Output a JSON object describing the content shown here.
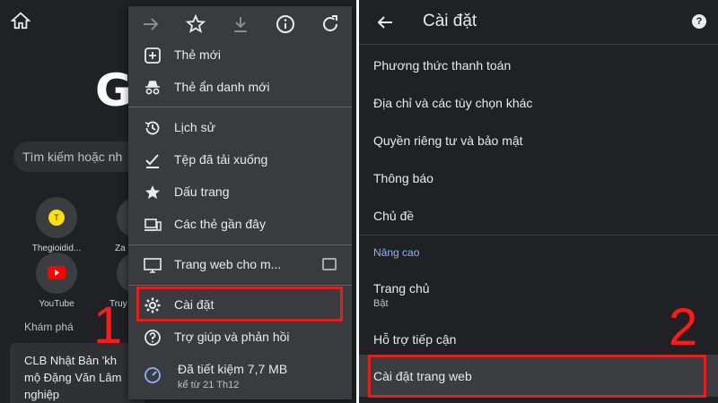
{
  "left": {
    "google_letter": "G",
    "search_placeholder": "Tìm kiếm hoặc nh",
    "shortcuts": [
      {
        "label": "Thegioidid...",
        "initial": "T"
      },
      {
        "label": "Za"
      },
      {
        "label": "YouTube"
      },
      {
        "label": "Truy"
      }
    ],
    "discover_label": "Khám phá",
    "news_text_lines": [
      "CLB Nhật Bản 'kh",
      "mộ Đặng Văn Lâm",
      "nghiệp"
    ]
  },
  "menu": {
    "toolbar_icons": [
      "forward-icon",
      "star-icon",
      "download-icon",
      "info-icon",
      "refresh-icon"
    ],
    "items": [
      {
        "label": "Thẻ mới",
        "icon": "plus-box-icon"
      },
      {
        "label": "Thẻ ẩn danh mới",
        "icon": "incognito-icon"
      },
      {
        "label": "Lịch sử",
        "icon": "history-icon"
      },
      {
        "label": "Tệp đã tải xuống",
        "icon": "download-check-icon"
      },
      {
        "label": "Dấu trang",
        "icon": "star-filled-icon"
      },
      {
        "label": "Các thẻ gần đây",
        "icon": "devices-icon"
      },
      {
        "label": "Trang web cho m...",
        "icon": "monitor-icon"
      },
      {
        "label": "Cài đặt",
        "icon": "gear-icon"
      },
      {
        "label": "Trợ giúp và phản hồi",
        "icon": "help-circle-icon"
      },
      {
        "label": "Đã tiết kiệm 7,7 MB",
        "icon": "speed-icon",
        "sub": "kể từ 21 Th12"
      }
    ]
  },
  "settings": {
    "title": "Cài đặt",
    "items": [
      "Phương thức thanh toán",
      "Địa chỉ và các tùy chọn khác",
      "Quyền riêng tư và bảo mật",
      "Thông báo",
      "Chủ đề"
    ],
    "section_advanced": "Nâng cao",
    "home_label": "Trang chủ",
    "home_value": "Bật",
    "accessibility": "Hỗ trợ tiếp cận",
    "site_settings": "Cài đặt trang web"
  },
  "annotations": {
    "step1": "1",
    "step2": "2",
    "highlight_color": "#e01f1f"
  }
}
